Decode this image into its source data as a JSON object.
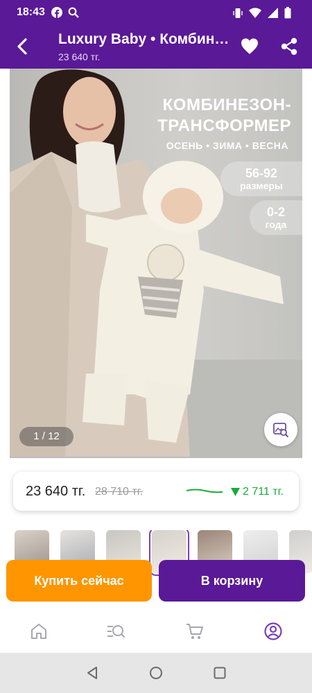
{
  "status_bar": {
    "time": "18:43",
    "left_icons": [
      "facebook-icon",
      "search-icon"
    ],
    "right_icons": [
      "vibrate-icon",
      "wifi-icon",
      "signal-icon",
      "battery-icon"
    ]
  },
  "app_bar": {
    "title": "Luxury Baby • Комбинезон-трансформер",
    "price": "23 640 тг.",
    "icons": [
      "back-arrow-icon",
      "heart-icon",
      "share-icon"
    ]
  },
  "product_image": {
    "headline_line1": "КОМБИНЕЗОН-",
    "headline_line2": "ТРАНСФОРМЕР",
    "seasons": "ОСЕНЬ • ЗИМА • ВЕСНА",
    "sizes_value": "56-92",
    "sizes_label": "размеры",
    "age_value": "0-2",
    "age_label": "года",
    "counter": "1 / 12",
    "zoom_icon": "image-search-icon"
  },
  "price_card": {
    "current_price": "23 640 тг.",
    "old_price": "28 710 тг.",
    "drop_amount": "2 711 тг.",
    "drop_icon": "triangle-down-icon",
    "accent_color": "#1aab3a"
  },
  "thumbnails": {
    "count_visible": 7,
    "active_index": 3
  },
  "actions": {
    "buy_now": "Купить сейчас",
    "add_to_cart": "В корзину",
    "buy_color": "#ff9500",
    "cart_color": "#5a1997"
  },
  "bottom_nav": {
    "items": [
      "home-icon",
      "catalog-search-icon",
      "cart-icon",
      "profile-icon"
    ],
    "active": "profile-icon"
  },
  "system_nav": {
    "items": [
      "back-triangle-icon",
      "home-circle-icon",
      "recents-square-icon"
    ]
  }
}
